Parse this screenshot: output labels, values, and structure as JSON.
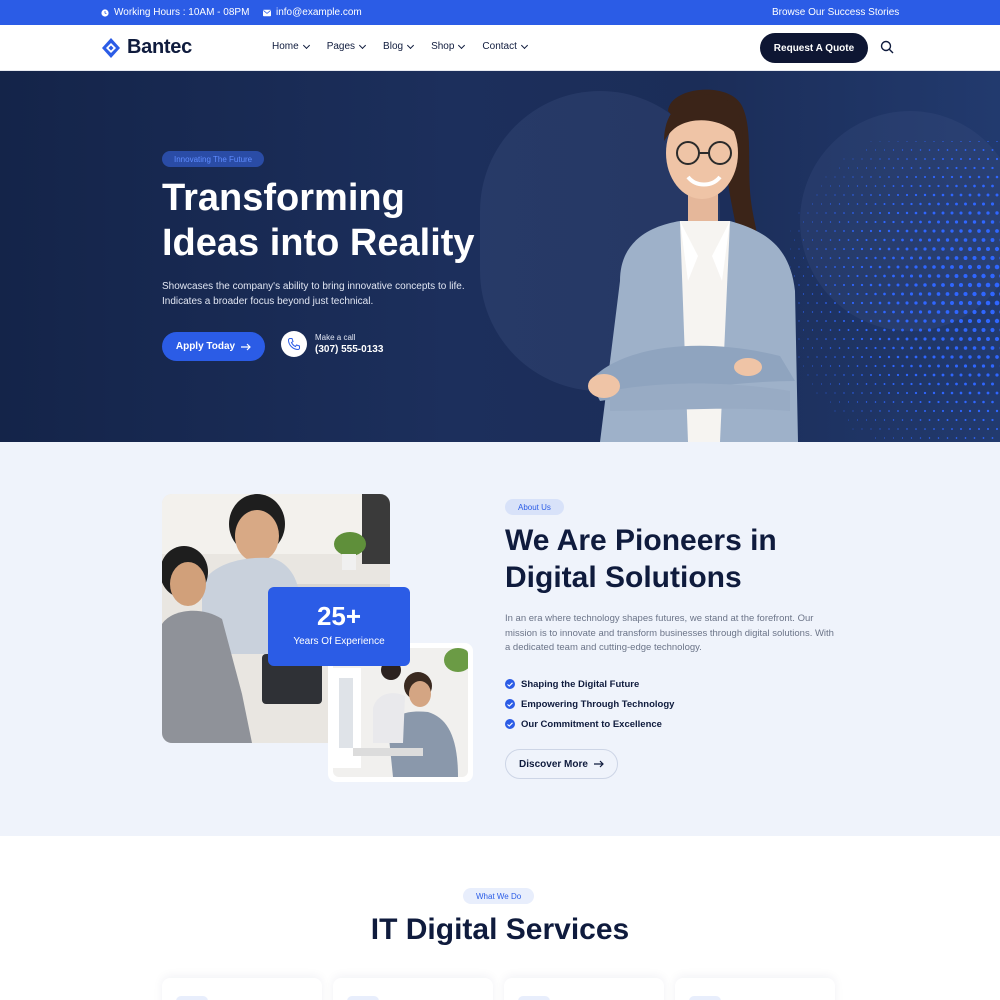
{
  "topbar": {
    "hours": "Working Hours : 10AM - 08PM",
    "email": "info@example.com",
    "stories": "Browse Our Success Stories"
  },
  "nav": {
    "brand": "Bantec",
    "menu": [
      "Home",
      "Pages",
      "Blog",
      "Shop",
      "Contact"
    ],
    "cta": "Request A Quote"
  },
  "hero": {
    "tag": "Innovating The Future",
    "title_line1": "Transforming",
    "title_line2": "Ideas into Reality",
    "desc_line1": "Showcases the company's ability to bring innovative concepts to life.",
    "desc_line2": "Indicates a broader focus beyond just technical.",
    "apply": "Apply Today",
    "call_label": "Make a call",
    "call_phone": "(307) 555-0133"
  },
  "about": {
    "tag": "About Us",
    "title_line1": "We Are Pioneers in",
    "title_line2": "Digital Solutions",
    "desc": "In an era where technology shapes futures, we stand at the forefront. Our mission is to innovate and transform businesses through digital solutions. With a dedicated team and cutting-edge technology.",
    "experience_num": "25+",
    "experience_label": "Years Of Experience",
    "checks": [
      "Shaping the Digital Future",
      "Empowering Through Technology",
      "Our Commitment to Excellence"
    ],
    "cta": "Discover More"
  },
  "services": {
    "tag": "What We Do",
    "title": "IT Digital Services"
  },
  "colors": {
    "accent": "#2b5ce6",
    "dark": "#0f1b3d",
    "hero_bg": "#1c2f5c",
    "about_bg": "#eff3fb"
  },
  "icons": [
    "clock-icon",
    "mail-icon",
    "logo-icon",
    "search-icon",
    "arrow-right-icon",
    "phone-icon",
    "check-icon"
  ]
}
